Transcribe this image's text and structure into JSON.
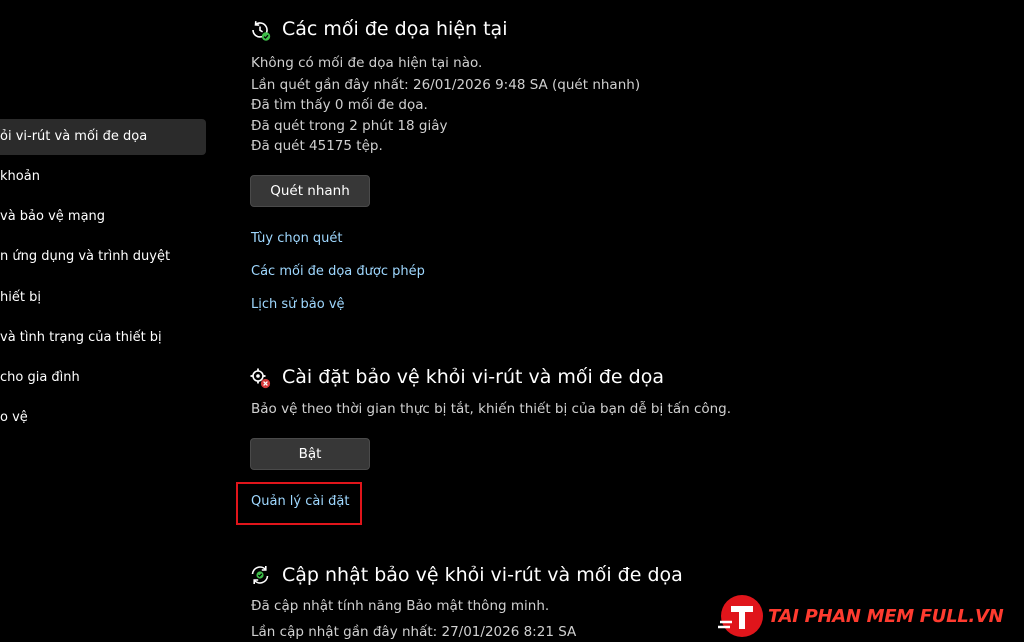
{
  "sidebar": {
    "items": [
      {
        "label": "ỏi vi-rút và mối đe dọa",
        "active": true
      },
      {
        "label": "khoản"
      },
      {
        "label": "và bảo vệ mạng"
      },
      {
        "label": "n ứng dụng và trình duyệt"
      },
      {
        "label": "hiết bị"
      },
      {
        "label": "và tình trạng của thiết bị"
      },
      {
        "label": "cho gia đình"
      },
      {
        "label": "o vệ"
      }
    ]
  },
  "threats": {
    "title": "Các mối đe dọa hiện tại",
    "icon": "clock-refresh-icon",
    "status": "Không có mối đe dọa hiện tại nào.",
    "last_scan": "Lần quét gần đây nhất: 26/01/2026 9:48 SA (quét nhanh)",
    "found": "Đã tìm thấy 0 mối đe dọa.",
    "duration": "Đã quét trong 2 phút 18 giây",
    "files": "Đã quét 45175 tệp.",
    "quick_scan_label": "Quét nhanh",
    "links": [
      "Tùy chọn quét",
      "Các mối đe dọa được phép",
      "Lịch sử bảo vệ"
    ]
  },
  "settings": {
    "title": "Cài đặt bảo vệ khỏi vi-rút và mối đe dọa",
    "icon": "gear-warning-icon",
    "description": "Bảo vệ theo thời gian thực bị tắt, khiến thiết bị của bạn dễ bị tấn công.",
    "turn_on_label": "Bật",
    "manage_link": "Quản lý cài đặt"
  },
  "updates": {
    "title": "Cập nhật bảo vệ khỏi vi-rút và mối đe dọa",
    "icon": "sync-icon",
    "status": "Đã cập nhật tính năng Bảo mật thông minh.",
    "last_update": "Lần cập nhật gần đây nhất: 27/01/2026 8:21 SA"
  },
  "watermark": {
    "text": "TAI PHAN MEM FULL.VN",
    "color": "#ff3b2f"
  },
  "colors": {
    "link": "#9fd8ff",
    "highlight": "#e0151b",
    "ok_green": "#3fbf4a"
  }
}
